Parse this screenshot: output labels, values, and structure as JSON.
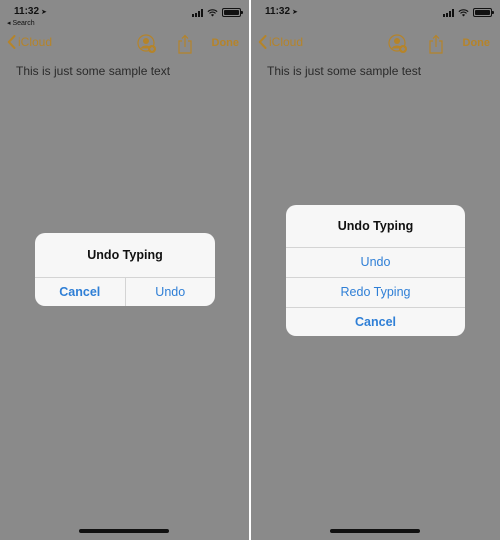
{
  "colors": {
    "accent": "#b5842a",
    "link": "#2f7fd6",
    "dimmed_background": "#8a8a8a",
    "alert_background": "#f7f7f7"
  },
  "icons": {
    "location": "location-arrow-icon",
    "back": "chevron-left-icon",
    "collaborate": "add-person-icon",
    "share": "share-icon",
    "wifi": "wifi-icon",
    "signal": "signal-icon",
    "battery": "battery-icon"
  },
  "left": {
    "status": {
      "time": "11:32",
      "back_app": "◂ Search"
    },
    "nav": {
      "back_label": "iCloud",
      "done_label": "Done"
    },
    "note_text": "This is just some sample text",
    "alert": {
      "title": "Undo Typing",
      "cancel": "Cancel",
      "undo": "Undo"
    }
  },
  "right": {
    "status": {
      "time": "11:32"
    },
    "nav": {
      "back_label": "iCloud",
      "done_label": "Done"
    },
    "note_text": "This is just some sample test",
    "alert": {
      "title": "Undo Typing",
      "undo": "Undo",
      "redo": "Redo Typing",
      "cancel": "Cancel"
    }
  }
}
